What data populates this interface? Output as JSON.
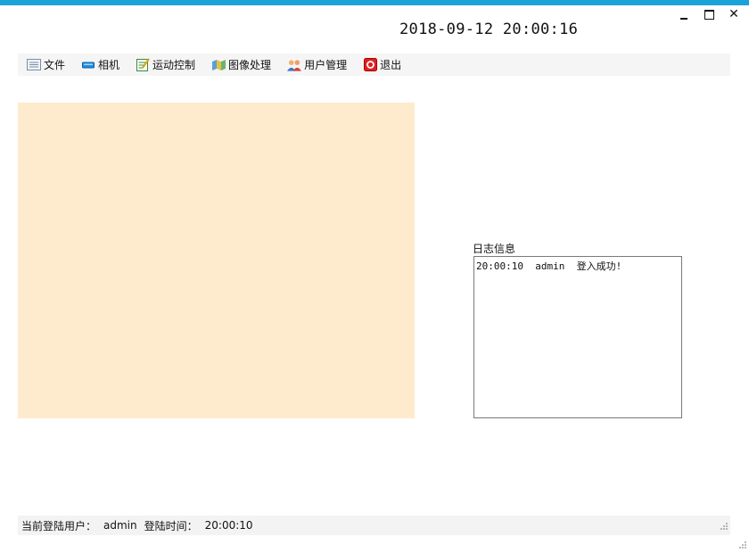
{
  "window": {
    "controls": {
      "minimize": "minimize",
      "maximize": "maximize",
      "close": "✕"
    }
  },
  "clock": {
    "text": "2018-09-12  20:00:16"
  },
  "menu": {
    "items": [
      {
        "label": "文件",
        "icon": "file-icon"
      },
      {
        "label": "相机",
        "icon": "camera-icon"
      },
      {
        "label": "运动控制",
        "icon": "motion-control-icon"
      },
      {
        "label": "图像处理",
        "icon": "image-processing-icon"
      },
      {
        "label": "用户管理",
        "icon": "users-icon"
      },
      {
        "label": "退出",
        "icon": "exit-icon"
      }
    ]
  },
  "log": {
    "label": "日志信息",
    "lines": [
      "20:00:10  admin  登入成功!"
    ]
  },
  "status": {
    "current_user_label": "当前登陆用户：",
    "current_user": "admin",
    "login_time_label": "登陆时间：",
    "login_time": "20:00:10"
  },
  "colors": {
    "accent": "#1aa3d9",
    "image_bg": "#feebce"
  }
}
